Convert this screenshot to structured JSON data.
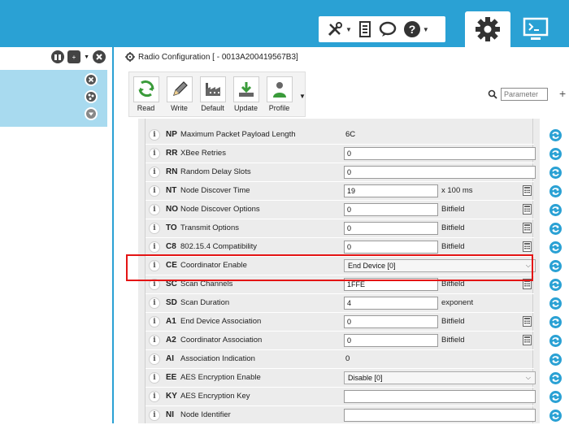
{
  "app": {
    "colors": {
      "accent": "#2aa1d4",
      "highlight": "#e41414"
    }
  },
  "topbar": {
    "tools_icon": "tools-icon",
    "document_icon": "document-icon",
    "chat_icon": "chat-icon",
    "help_icon": "help-icon",
    "config_icon": "gear-icon",
    "console_icon": "console-icon"
  },
  "main": {
    "title": "Radio Configuration [  - 0013A200419567B3]",
    "toolbar": {
      "read": "Read",
      "write": "Write",
      "default": "Default",
      "update": "Update",
      "profile": "Profile"
    },
    "search": {
      "placeholder": "Parameter"
    }
  },
  "params": [
    {
      "code": "NP",
      "name": "Maximum Packet Payload Length",
      "kind": "ro",
      "value": "6C"
    },
    {
      "code": "RR",
      "name": "XBee Retries",
      "kind": "text",
      "value": "0"
    },
    {
      "code": "RN",
      "name": "Random Delay Slots",
      "kind": "text",
      "value": "0"
    },
    {
      "code": "NT",
      "name": "Node Discover Time",
      "kind": "text-unit",
      "value": "19",
      "unit": "x 100 ms",
      "calc": true
    },
    {
      "code": "NO",
      "name": "Node Discover Options",
      "kind": "text-unit",
      "value": "0",
      "unit": "Bitfield",
      "calc": true
    },
    {
      "code": "TO",
      "name": "Transmit Options",
      "kind": "text-unit",
      "value": "0",
      "unit": "Bitfield",
      "calc": true
    },
    {
      "code": "C8",
      "name": "802.15.4 Compatibility",
      "kind": "text-unit",
      "value": "0",
      "unit": "Bitfield",
      "calc": true
    },
    {
      "code": "CE",
      "name": "Coordinator Enable",
      "kind": "select",
      "value": "End Device [0]"
    },
    {
      "code": "SC",
      "name": "Scan Channels",
      "kind": "text-unit",
      "value": "1FFE",
      "unit": "Bitfield",
      "calc": true
    },
    {
      "code": "SD",
      "name": "Scan Duration",
      "kind": "text-unit",
      "value": "4",
      "unit": "exponent"
    },
    {
      "code": "A1",
      "name": "End Device Association",
      "kind": "text-unit",
      "value": "0",
      "unit": "Bitfield",
      "calc": true
    },
    {
      "code": "A2",
      "name": "Coordinator Association",
      "kind": "text-unit",
      "value": "0",
      "unit": "Bitfield",
      "calc": true
    },
    {
      "code": "AI",
      "name": "Association Indication",
      "kind": "ro",
      "value": "0"
    },
    {
      "code": "EE",
      "name": "AES Encryption Enable",
      "kind": "select",
      "value": "Disable [0]"
    },
    {
      "code": "KY",
      "name": "AES Encryption Key",
      "kind": "text",
      "value": ""
    },
    {
      "code": "NI",
      "name": "Node Identifier",
      "kind": "text",
      "value": ""
    }
  ]
}
